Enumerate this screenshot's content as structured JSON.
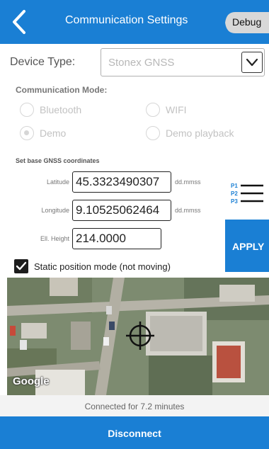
{
  "header": {
    "title": "Communication Settings",
    "debug_label": "Debug",
    "back_icon": "chevron-left-icon",
    "bar_color": "#1a7fd4"
  },
  "device": {
    "label": "Device Type:",
    "value": "Stonex GNSS",
    "dropdown_icon": "chevron-down-icon"
  },
  "communication_mode": {
    "title": "Communication Mode:",
    "options": [
      {
        "label": "Bluetooth",
        "selected": false
      },
      {
        "label": "WIFI",
        "selected": false
      },
      {
        "label": "Demo",
        "selected": true
      },
      {
        "label": "Demo playback",
        "selected": false
      }
    ]
  },
  "base": {
    "title": "Set base GNSS coordinates",
    "latitude": {
      "label": "Latitude",
      "value": "45.3323490307",
      "unit": "dd.mmss"
    },
    "longitude": {
      "label": "Longitude",
      "value": "9.10525062464",
      "unit": "dd.mmss"
    },
    "height": {
      "label": "Ell. Height",
      "value": "214.0000"
    }
  },
  "profiles": [
    "P1",
    "P2",
    "P3"
  ],
  "apply_label": "APPLY",
  "static_mode": {
    "label": "Static position mode (not moving)",
    "checked": true
  },
  "map": {
    "attribution": "Google",
    "crosshair_icon": "crosshair-icon"
  },
  "status": {
    "text": "Connected for 7.2 minutes"
  },
  "disconnect_label": "Disconnect"
}
